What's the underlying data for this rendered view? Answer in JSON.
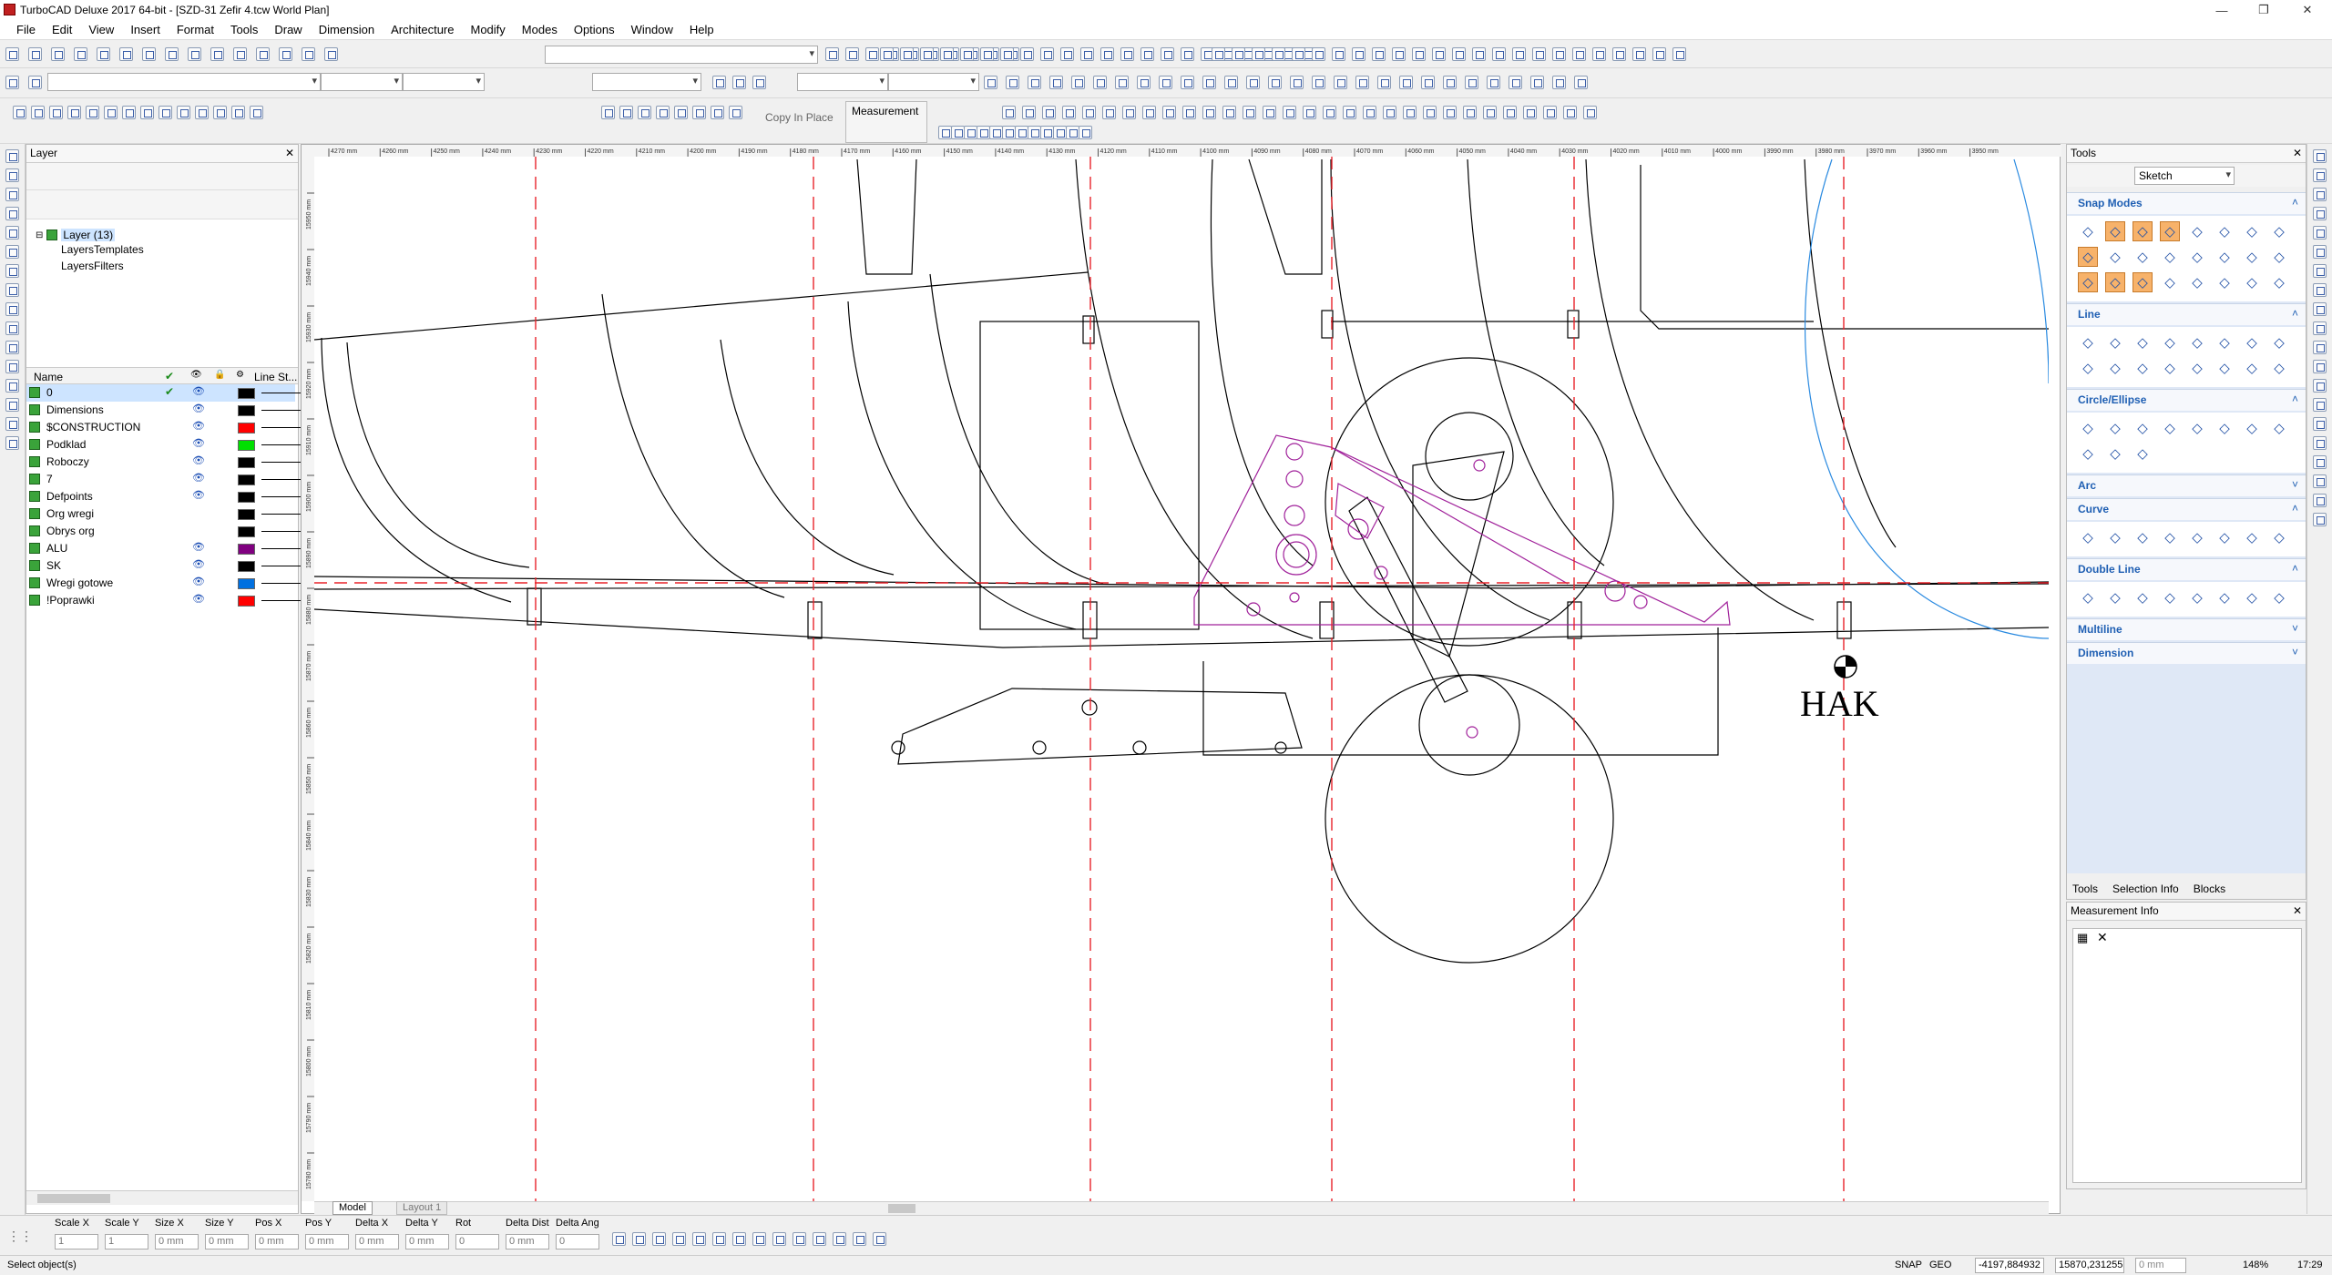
{
  "window": {
    "title": "TurboCAD Deluxe 2017 64-bit - [SZD-31 Zefir 4.tcw World Plan]",
    "min": "—",
    "max": "❐",
    "close": "✕"
  },
  "menu": [
    "File",
    "Edit",
    "View",
    "Insert",
    "Format",
    "Tools",
    "Draw",
    "Dimension",
    "Architecture",
    "Modify",
    "Modes",
    "Options",
    "Window",
    "Help"
  ],
  "toolbar": {
    "copy_in_place": "Copy In Place",
    "measurement": "Measurement"
  },
  "layer_panel": {
    "title": "Layer",
    "tree": {
      "root": "Layer (13)",
      "children": [
        "LayersTemplates",
        "LayersFilters"
      ]
    },
    "columns": [
      "Name",
      "✔",
      "👁",
      "🔒",
      "⚙",
      "Line St..."
    ],
    "rows": [
      {
        "name": "0",
        "current": true,
        "visible": true,
        "color": "#000000"
      },
      {
        "name": "Dimensions",
        "current": false,
        "visible": true,
        "color": "#000000"
      },
      {
        "name": "$CONSTRUCTION",
        "current": false,
        "visible": true,
        "color": "#ff0000"
      },
      {
        "name": "Podklad",
        "current": false,
        "visible": true,
        "color": "#00e000"
      },
      {
        "name": "Roboczy",
        "current": false,
        "visible": true,
        "color": "#000000"
      },
      {
        "name": "7",
        "current": false,
        "visible": true,
        "color": "#000000"
      },
      {
        "name": "Defpoints",
        "current": false,
        "visible": true,
        "color": "#000000"
      },
      {
        "name": "Org wregi",
        "current": false,
        "visible": false,
        "color": "#000000"
      },
      {
        "name": "Obrys org",
        "current": false,
        "visible": false,
        "color": "#000000"
      },
      {
        "name": "ALU",
        "current": false,
        "visible": true,
        "color": "#800080"
      },
      {
        "name": "SK",
        "current": false,
        "visible": true,
        "color": "#000000"
      },
      {
        "name": "Wregi gotowe",
        "current": false,
        "visible": true,
        "color": "#0070e0"
      },
      {
        "name": "!Poprawki",
        "current": false,
        "visible": true,
        "color": "#ff0000"
      }
    ]
  },
  "ruler": {
    "top_labels": [
      "4270 mm",
      "4260 mm",
      "4250 mm",
      "4240 mm",
      "4230 mm",
      "4220 mm",
      "4210 mm",
      "4200 mm",
      "4190 mm",
      "4180 mm",
      "4170 mm",
      "4160 mm",
      "4150 mm",
      "4140 mm",
      "4130 mm",
      "4120 mm",
      "4110 mm",
      "4100 mm",
      "4090 mm",
      "4080 mm",
      "4070 mm",
      "4060 mm",
      "4050 mm",
      "4040 mm",
      "4030 mm",
      "4020 mm",
      "4010 mm",
      "4000 mm",
      "3990 mm",
      "3980 mm",
      "3970 mm",
      "3960 mm",
      "3950 mm"
    ],
    "left_labels": [
      "15950 mm",
      "15940 mm",
      "15930 mm",
      "15920 mm",
      "15910 mm",
      "15900 mm",
      "15890 mm",
      "15880 mm",
      "15870 mm",
      "15860 mm",
      "15850 mm",
      "15840 mm",
      "15830 mm",
      "15820 mm",
      "15810 mm",
      "15800 mm",
      "15790 mm",
      "15780 mm"
    ]
  },
  "drawing": {
    "label": "HAK"
  },
  "tabs": {
    "model": "Model",
    "layout": "Layout 1"
  },
  "tools_panel": {
    "title": "Tools",
    "mode": "Sketch",
    "sections": [
      {
        "name": "Snap Modes",
        "open": true
      },
      {
        "name": "Line",
        "open": true
      },
      {
        "name": "Circle/Ellipse",
        "open": true
      },
      {
        "name": "Arc",
        "open": false
      },
      {
        "name": "Curve",
        "open": true
      },
      {
        "name": "Double Line",
        "open": true
      },
      {
        "name": "Multiline",
        "open": false
      },
      {
        "name": "Dimension",
        "open": false
      }
    ],
    "bottom_tabs": [
      "Tools",
      "Selection Info",
      "Blocks"
    ]
  },
  "measurement_panel": {
    "title": "Measurement Info"
  },
  "inspector": {
    "fields": [
      {
        "label": "Scale X",
        "value": "1"
      },
      {
        "label": "Scale Y",
        "value": "1"
      },
      {
        "label": "Size X",
        "value": "0 mm"
      },
      {
        "label": "Size Y",
        "value": "0 mm"
      },
      {
        "label": "Pos X",
        "value": "0 mm"
      },
      {
        "label": "Pos Y",
        "value": "0 mm"
      },
      {
        "label": "Delta X",
        "value": "0 mm"
      },
      {
        "label": "Delta Y",
        "value": "0 mm"
      },
      {
        "label": "Rot",
        "value": "0"
      },
      {
        "label": "Delta Dist",
        "value": "0 mm"
      },
      {
        "label": "Delta Ang",
        "value": "0"
      }
    ]
  },
  "status": {
    "message": "Select object(s)",
    "snap": "SNAP",
    "geo": "GEO",
    "x": "-4197,884932",
    "y": "15870,231255",
    "z": "0 mm",
    "zoom": "148%",
    "time": "17:29"
  },
  "colors": {
    "construction": "#e8232a",
    "alu": "#a0209a",
    "wregi": "#2a8ae0"
  }
}
